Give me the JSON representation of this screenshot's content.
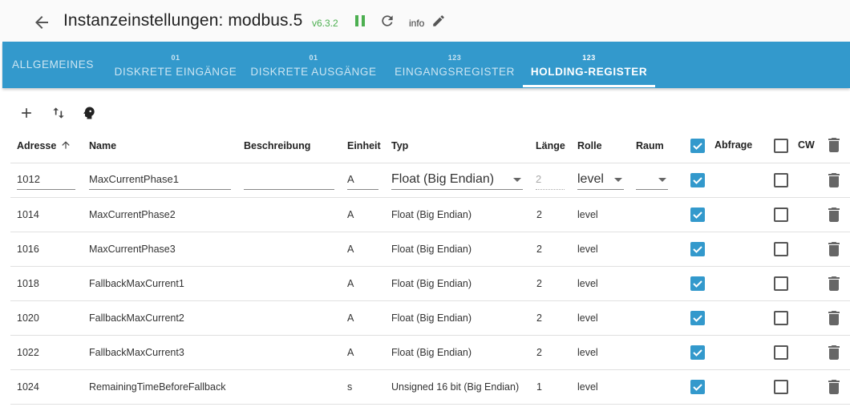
{
  "header": {
    "title": "Instanzeinstellungen: modbus.5",
    "version": "v6.3.2",
    "info": "info"
  },
  "tabs": [
    {
      "sup": "",
      "label": "ALLGEMEINES"
    },
    {
      "sup": "01",
      "label": "DISKRETE EINGÄNGE"
    },
    {
      "sup": "01",
      "label": "DISKRETE AUSGÄNGE"
    },
    {
      "sup": "123",
      "label": "EINGANGSREGISTER"
    },
    {
      "sup": "123",
      "label": "HOLDING-REGISTER"
    }
  ],
  "table": {
    "headers": {
      "adresse": "Adresse",
      "name": "Name",
      "beschreibung": "Beschreibung",
      "einheit": "Einheit",
      "typ": "Typ",
      "laenge": "Länge",
      "rolle": "Rolle",
      "raum": "Raum",
      "abfrage": "Abfrage",
      "cw": "CW"
    },
    "edit_row": {
      "adresse": "1012",
      "name": "MaxCurrentPhase1",
      "beschreibung": "",
      "einheit": "A",
      "typ": "Float (Big Endian)",
      "laenge": "2",
      "rolle": "level",
      "raum": ""
    },
    "rows": [
      {
        "adresse": "1014",
        "name": "MaxCurrentPhase2",
        "einheit": "A",
        "typ": "Float (Big Endian)",
        "laenge": "2",
        "rolle": "level"
      },
      {
        "adresse": "1016",
        "name": "MaxCurrentPhase3",
        "einheit": "A",
        "typ": "Float (Big Endian)",
        "laenge": "2",
        "rolle": "level"
      },
      {
        "adresse": "1018",
        "name": "FallbackMaxCurrent1",
        "einheit": "A",
        "typ": "Float (Big Endian)",
        "laenge": "2",
        "rolle": "level"
      },
      {
        "adresse": "1020",
        "name": "FallbackMaxCurrent2",
        "einheit": "A",
        "typ": "Float (Big Endian)",
        "laenge": "2",
        "rolle": "level"
      },
      {
        "adresse": "1022",
        "name": "FallbackMaxCurrent3",
        "einheit": "A",
        "typ": "Float (Big Endian)",
        "laenge": "2",
        "rolle": "level"
      },
      {
        "adresse": "1024",
        "name": "RemainingTimeBeforeFallback",
        "einheit": "s",
        "typ": "Unsigned 16 bit (Big Endian)",
        "laenge": "1",
        "rolle": "level"
      }
    ]
  },
  "colors": {
    "accent": "#3399cc",
    "version_green": "#4caf50"
  }
}
